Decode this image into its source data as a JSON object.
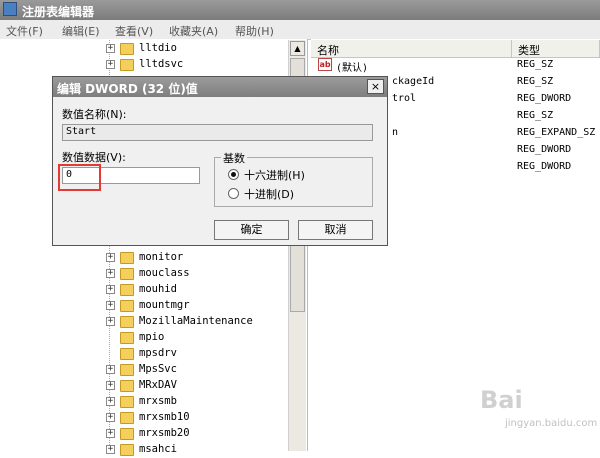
{
  "window": {
    "title": "注册表编辑器"
  },
  "menu": [
    "文件(F)",
    "编辑(E)",
    "查看(V)",
    "收藏夹(A)",
    "帮助(H)"
  ],
  "tree_items": [
    {
      "label": "lltdio",
      "expander": "+"
    },
    {
      "label": "lltdsvc",
      "expander": "+"
    },
    {
      "label": "monitor",
      "expander": "+"
    },
    {
      "label": "mouclass",
      "expander": "+"
    },
    {
      "label": "mouhid",
      "expander": "+"
    },
    {
      "label": "mountmgr",
      "expander": "+"
    },
    {
      "label": "MozillaMaintenance",
      "expander": "+"
    },
    {
      "label": "mpio",
      "expander": ""
    },
    {
      "label": "mpsdrv",
      "expander": ""
    },
    {
      "label": "MpsSvc",
      "expander": "+"
    },
    {
      "label": "MRxDAV",
      "expander": "+"
    },
    {
      "label": "mrxsmb",
      "expander": "+"
    },
    {
      "label": "mrxsmb10",
      "expander": "+"
    },
    {
      "label": "mrxsmb20",
      "expander": "+"
    },
    {
      "label": "msahci",
      "expander": "+"
    }
  ],
  "list": {
    "col_name": "名称",
    "col_type": "类型",
    "rows": [
      {
        "name": "(默认)",
        "type": "REG_SZ"
      },
      {
        "name": "ckageId",
        "type": "REG_SZ"
      },
      {
        "name": "trol",
        "type": "REG_DWORD"
      },
      {
        "name": "",
        "type": "REG_SZ"
      },
      {
        "name": "n",
        "type": "REG_EXPAND_SZ"
      },
      {
        "name": "",
        "type": "REG_DWORD"
      },
      {
        "name": "",
        "type": "REG_DWORD"
      }
    ]
  },
  "dialog": {
    "title": "编辑 DWORD (32 位)值",
    "close": "×",
    "name_label": "数值名称(N):",
    "name_value": "Start",
    "data_label": "数值数据(V):",
    "data_value": "0",
    "base_label": "基数",
    "hex_label": "十六进制(H)",
    "dec_label": "十进制(D)",
    "selected_base": "hex",
    "ok": "确定",
    "cancel": "取消"
  },
  "watermark": {
    "main": "Bai",
    "sub": "jingyan.baidu.com"
  },
  "icons": {
    "app": "registry-editor-icon",
    "string_value": "ab-string-icon",
    "folder": "folder-icon"
  }
}
